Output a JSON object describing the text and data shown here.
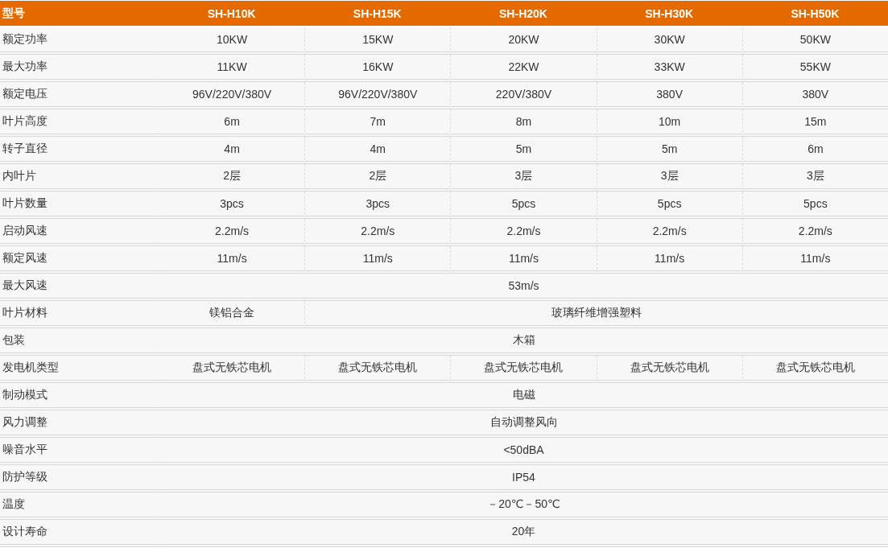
{
  "table": {
    "row_header": "型号",
    "columns": [
      "SH-H10K",
      "SH-H15K",
      "SH-H20K",
      "SH-H30K",
      "SH-H50K"
    ],
    "rows": [
      {
        "label": "额定功率",
        "cells": [
          "10KW",
          "15KW",
          "20KW",
          "30KW",
          "50KW"
        ]
      },
      {
        "label": "最大功率",
        "cells": [
          "11KW",
          "16KW",
          "22KW",
          "33KW",
          "55KW"
        ]
      },
      {
        "label": "额定电压",
        "cells": [
          "96V/220V/380V",
          "96V/220V/380V",
          "220V/380V",
          "380V",
          "380V"
        ]
      },
      {
        "label": "叶片高度",
        "cells": [
          "6m",
          "7m",
          "8m",
          "10m",
          "15m"
        ]
      },
      {
        "label": "转子直径",
        "cells": [
          "4m",
          "4m",
          "5m",
          "5m",
          "6m"
        ]
      },
      {
        "label": "内叶片",
        "cells": [
          "2层",
          "2层",
          "3层",
          "3层",
          "3层"
        ]
      },
      {
        "label": "叶片数量",
        "cells": [
          "3pcs",
          "3pcs",
          "5pcs",
          "5pcs",
          "5pcs"
        ]
      },
      {
        "label": "启动风速",
        "cells": [
          "2.2m/s",
          "2.2m/s",
          "2.2m/s",
          "2.2m/s",
          "2.2m/s"
        ]
      },
      {
        "label": "额定风速",
        "cells": [
          "11m/s",
          "11m/s",
          "11m/s",
          "11m/s",
          "11m/s"
        ]
      },
      {
        "label": "最大风速",
        "cells": [
          {
            "text": "53m/s",
            "colspan": 5
          }
        ]
      },
      {
        "label": "叶片材料",
        "cells": [
          "镁铝合金",
          {
            "text": "玻璃纤维增强塑料",
            "colspan": 4
          }
        ]
      },
      {
        "label": "包装",
        "cells": [
          {
            "text": "木箱",
            "colspan": 5
          }
        ]
      },
      {
        "label": "发电机类型",
        "cells": [
          "盘式无铁芯电机",
          "盘式无铁芯电机",
          "盘式无铁芯电机",
          "盘式无铁芯电机",
          "盘式无铁芯电机"
        ]
      },
      {
        "label": "制动模式",
        "cells": [
          {
            "text": "电磁",
            "colspan": 5
          }
        ]
      },
      {
        "label": "风力调整",
        "cells": [
          {
            "text": "自动调整风向",
            "colspan": 5
          }
        ]
      },
      {
        "label": "噪音水平",
        "cells": [
          {
            "text": "<50dBA",
            "colspan": 5
          }
        ]
      },
      {
        "label": "防护等级",
        "cells": [
          {
            "text": "IP54",
            "colspan": 5
          }
        ]
      },
      {
        "label": "温度",
        "cells": [
          {
            "text": "－20℃－50℃",
            "colspan": 5
          }
        ]
      },
      {
        "label": "设计寿命",
        "cells": [
          {
            "text": "20年",
            "colspan": 5
          }
        ]
      }
    ]
  }
}
